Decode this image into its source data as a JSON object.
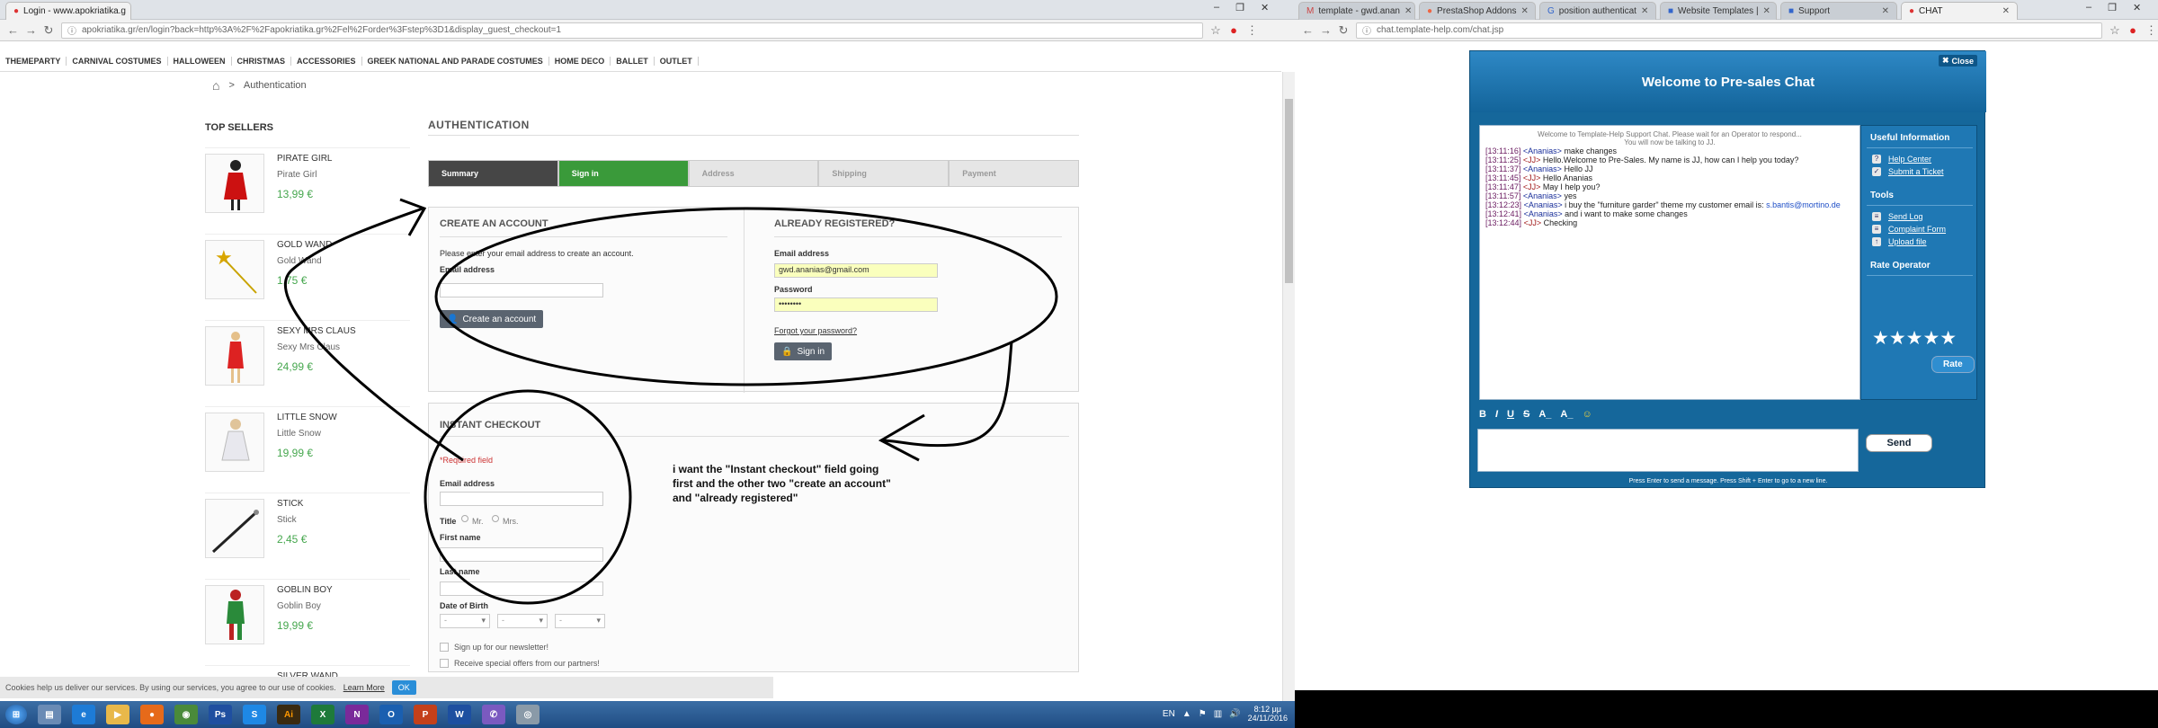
{
  "left_browser": {
    "tabs": [
      {
        "title": "Login - www.apokriatika.g"
      }
    ],
    "url": "apokriatika.gr/en/login?back=http%3A%2F%2Fapokriatika.gr%2Fel%2Forder%3Fstep%3D1&display_guest_checkout=1",
    "url_host": "apokriatika.gr"
  },
  "right_browser": {
    "tabs": [
      {
        "title": "template - gwd.anan"
      },
      {
        "title": "PrestaShop Addons"
      },
      {
        "title": "position authenticat"
      },
      {
        "title": "Website Templates |"
      },
      {
        "title": "Support"
      },
      {
        "title": "CHAT"
      }
    ],
    "url": "chat.template-help.com/chat.jsp"
  },
  "site": {
    "menu": [
      "THEMEPARTY",
      "CARNIVAL COSTUMES",
      "HALLOWEEN",
      "CHRISTMAS",
      "ACCESSORIES",
      "GREEK NATIONAL AND PARADE COSTUMES",
      "HOME DECO",
      "BALLET",
      "OUTLET"
    ],
    "breadcrumb": "Authentication",
    "top_sellers_title": "TOP SELLERS",
    "products": [
      {
        "name": "PIRATE GIRL",
        "subtitle": "Pirate Girl",
        "price": "13,99 €"
      },
      {
        "name": "GOLD WAND",
        "subtitle": "Gold Wand",
        "price": "1,75 €"
      },
      {
        "name": "SEXY MRS CLAUS",
        "subtitle": "Sexy Mrs Claus",
        "price": "24,99 €"
      },
      {
        "name": "LITTLE SNOW",
        "subtitle": "Little Snow",
        "price": "19,99 €"
      },
      {
        "name": "STICK",
        "subtitle": "Stick",
        "price": "2,45 €"
      },
      {
        "name": "GOBLIN BOY",
        "subtitle": "Goblin Boy",
        "price": "19,99 €"
      },
      {
        "name": "SILVER WAND",
        "subtitle": "",
        "price": ""
      }
    ],
    "auth_title": "AUTHENTICATION",
    "steps": [
      "Summary",
      "Sign in",
      "Address",
      "Shipping",
      "Payment"
    ],
    "create": {
      "title": "CREATE AN ACCOUNT",
      "intro": "Please enter your email address to create an account.",
      "email_label": "Email address",
      "button": "Create an account"
    },
    "registered": {
      "title": "ALREADY REGISTERED?",
      "email_label": "Email address",
      "email_value": "gwd.ananias@gmail.com",
      "password_label": "Password",
      "password_value": "••••••••",
      "forgot": "Forgot your password?",
      "button": "Sign in"
    },
    "instant": {
      "title": "INSTANT CHECKOUT",
      "required": "*Required field",
      "email_label": "Email address",
      "title_label": "Title",
      "mr": "Mr.",
      "mrs": "Mrs.",
      "first_name": "First name",
      "last_name": "Last name",
      "dob": "Date of Birth",
      "dash": "-",
      "newsletter": "Sign up for our newsletter!",
      "offers": "Receive special offers from our partners!"
    },
    "annotation": "i want the \"Instant checkout\" field going first and the other two \"create an account\" and \"already registered\"",
    "cookie": {
      "text": "Cookies help us deliver our services. By using our services, you agree to our use of cookies.",
      "learn": "Learn More",
      "ok": "OK"
    }
  },
  "chat": {
    "close": "Close",
    "title": "Welcome to Pre-sales Chat",
    "system_1": "Welcome to Template-Help Support Chat. Please wait for an Operator to respond...",
    "system_2": "You will now be talking to JJ.",
    "messages": [
      {
        "time": "[13:11:16]",
        "who": "<Ananias>",
        "text": " make changes"
      },
      {
        "time": "[13:11:25]",
        "who": "<JJ>",
        "text": " Hello.Welcome to Pre-Sales. My name is JJ, how can I help you today?"
      },
      {
        "time": "[13:11:37]",
        "who": "<Ananias>",
        "text": " Hello JJ"
      },
      {
        "time": "[13:11:45]",
        "who": "<JJ>",
        "text": " Hello Ananias"
      },
      {
        "time": "[13:11:47]",
        "who": "<JJ>",
        "text": " May I help you?"
      },
      {
        "time": "[13:11:57]",
        "who": "<Ananias>",
        "text": " yes"
      },
      {
        "time": "[13:12:23]",
        "who": "<Ananias>",
        "text": " i buy the \"furniture garder\" theme my customer email is: ",
        "email": "s.bantis@mortino.de"
      },
      {
        "time": "[13:12:41]",
        "who": "<Ananias>",
        "text": " and i want to make some changes"
      },
      {
        "time": "[13:12:44]",
        "who": "<JJ>",
        "text": " Checking"
      }
    ],
    "useful_info": "Useful Information",
    "help_center": "Help Center",
    "submit_ticket": "Submit a Ticket",
    "tools": "Tools",
    "send_log": "Send Log",
    "complaint": "Complaint Form",
    "upload": "Upload file",
    "rate_operator": "Rate Operator",
    "rate": "Rate",
    "stars": "★★★★★",
    "send": "Send",
    "hint": "Press Enter to send a message. Press Shift + Enter to go to a new line."
  },
  "taskbar": {
    "lang": "EN",
    "time": "8:12 μμ",
    "date": "24/11/2016"
  }
}
